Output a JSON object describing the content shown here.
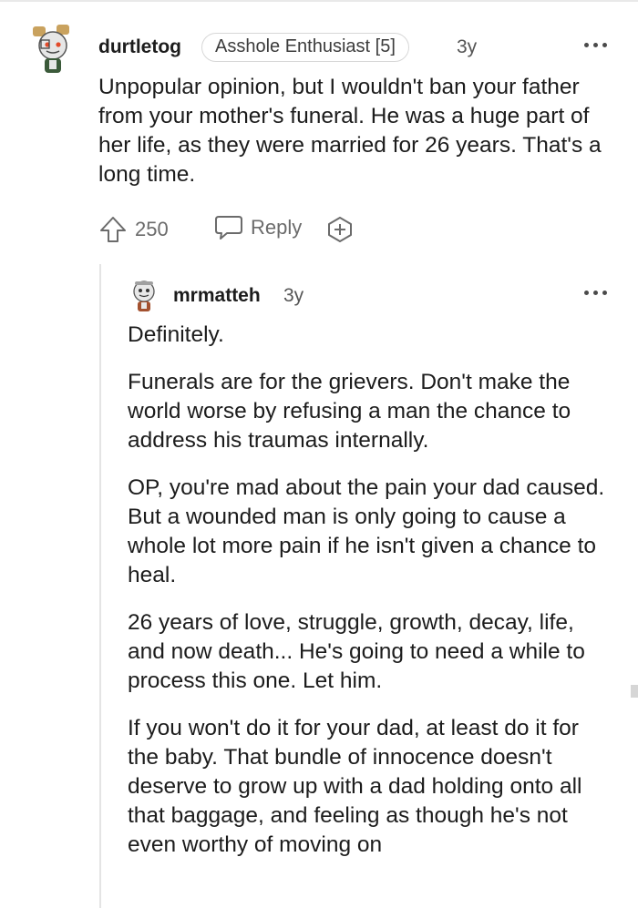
{
  "comment": {
    "username": "durtletog",
    "flair": "Asshole Enthusiast [5]",
    "age": "3y",
    "avatar_icon": "snoo-avatar-icon",
    "body": "Unpopular opinion, but I wouldn't ban your father from your mother's funeral. He was a huge part of her life, as they were married for 26 years. That's a long time.",
    "upvotes": "250",
    "reply_label": "Reply",
    "upvote_icon": "upvote-arrow-icon",
    "reply_icon": "speech-bubble-icon",
    "award_icon": "plus-circle-icon",
    "more_icon": "more-dots-icon"
  },
  "reply": {
    "username": "mrmatteh",
    "age": "3y",
    "avatar_icon": "snoo-avatar-icon",
    "more_icon": "more-dots-icon",
    "paragraphs": [
      "Definitely.",
      "Funerals are for the grievers. Don't make the world worse by refusing a man the chance to address his traumas internally.",
      "OP, you're mad about the pain your dad caused. But a wounded man is only going to cause a whole lot more pain if he isn't given a chance to heal.",
      "26 years of love, struggle, growth, decay, life, and now death... He's going to need a while to process this one. Let him.",
      "If you won't do it for your dad, at least do it for the baby. That bundle of innocence doesn't deserve to grow up with a dad holding onto all that baggage, and feeling as though he's not even worthy of moving on"
    ]
  },
  "colors": {
    "text": "#1c1c1c",
    "muted": "#6b6b6b",
    "border": "#d7d7d7"
  }
}
